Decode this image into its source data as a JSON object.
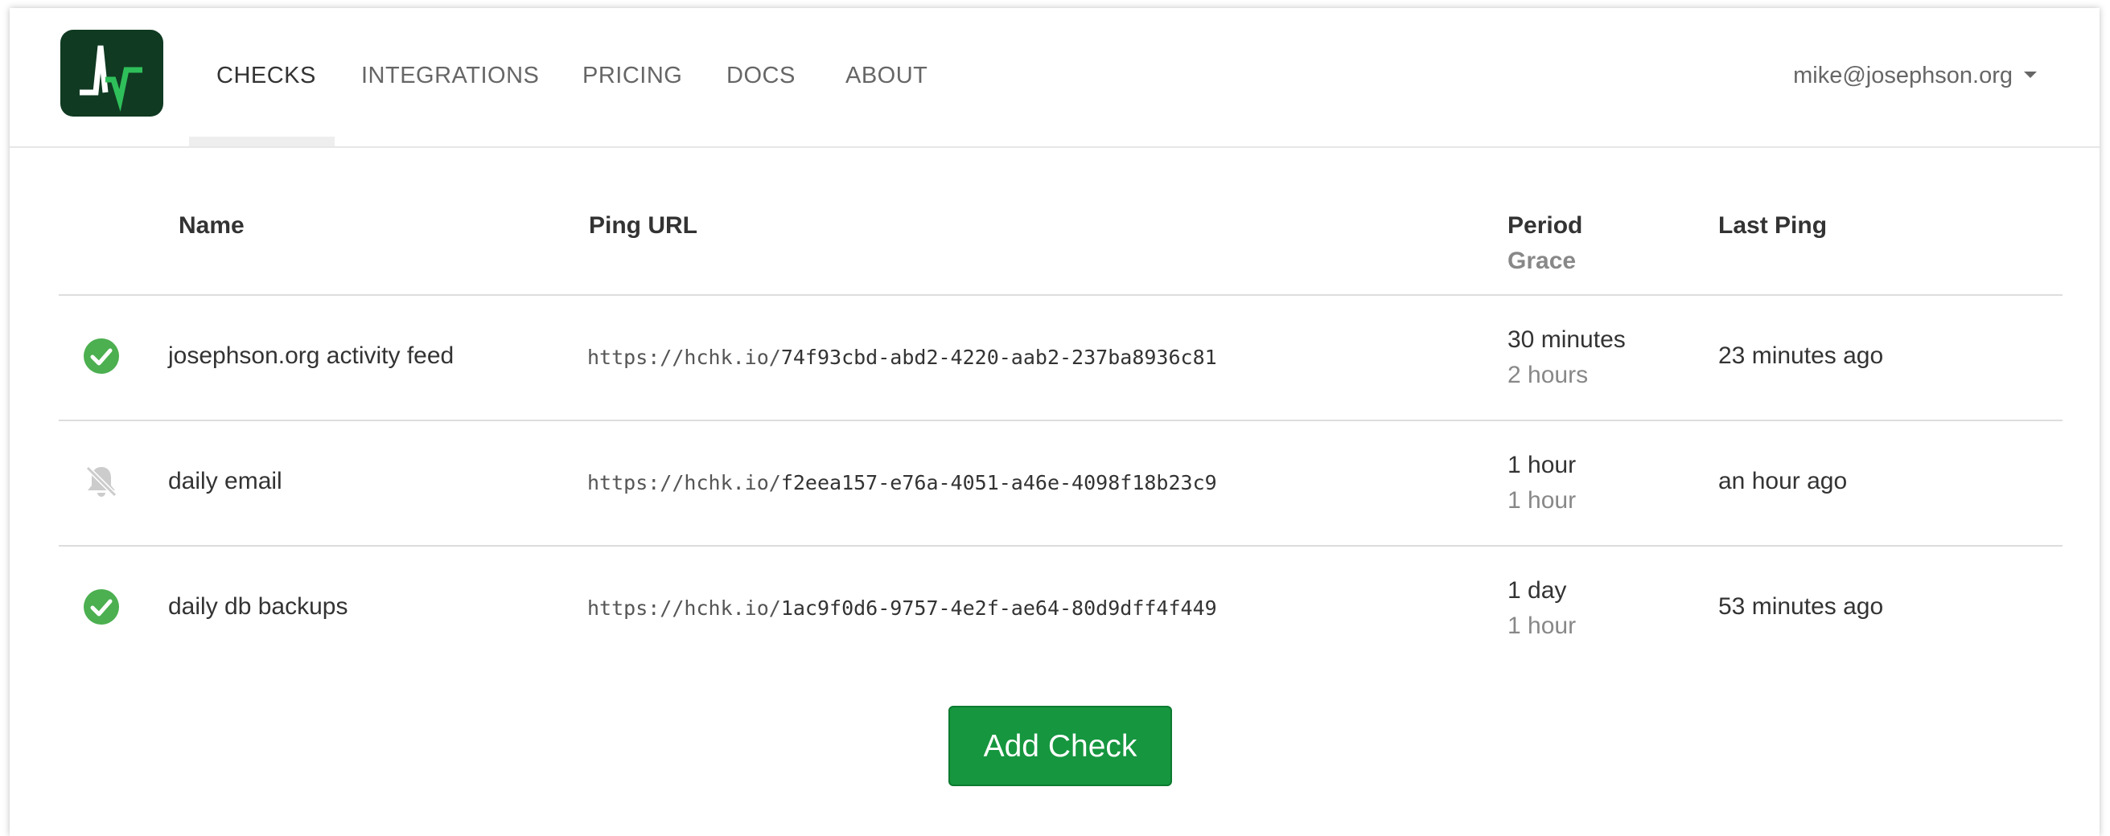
{
  "nav": {
    "items": [
      {
        "label": "CHECKS",
        "active": true
      },
      {
        "label": "INTEGRATIONS",
        "active": false
      },
      {
        "label": "PRICING",
        "active": false
      },
      {
        "label": "DOCS",
        "active": false
      },
      {
        "label": "ABOUT",
        "active": false
      }
    ],
    "user_email": "mike@josephson.org"
  },
  "table": {
    "headers": {
      "name": "Name",
      "ping_url": "Ping URL",
      "period": "Period",
      "grace": "Grace",
      "last_ping": "Last Ping"
    },
    "rows": [
      {
        "status": "up",
        "status_icon": "check-circle-icon",
        "name": "josephson.org activity feed",
        "url_base": "https://hchk.io/",
        "url_code": "74f93cbd-abd2-4220-aab2-237ba8936c81",
        "period": "30 minutes",
        "grace": "2 hours",
        "last_ping": "23 minutes ago"
      },
      {
        "status": "paused",
        "status_icon": "bell-slash-icon",
        "name": "daily email",
        "url_base": "https://hchk.io/",
        "url_code": "f2eea157-e76a-4051-a46e-4098f18b23c9",
        "period": "1 hour",
        "grace": "1 hour",
        "last_ping": "an hour ago"
      },
      {
        "status": "up",
        "status_icon": "check-circle-icon",
        "name": "daily db backups",
        "url_base": "https://hchk.io/",
        "url_code": "1ac9f0d6-9757-4e2f-ae64-80d9dff4f449",
        "period": "1 day",
        "grace": "1 hour",
        "last_ping": "53 minutes ago"
      }
    ]
  },
  "add_check_label": "Add Check",
  "colors": {
    "logo_bg": "#103a22",
    "status_up": "#4caf50",
    "status_paused": "#cccccc",
    "button_green": "#16963f"
  }
}
